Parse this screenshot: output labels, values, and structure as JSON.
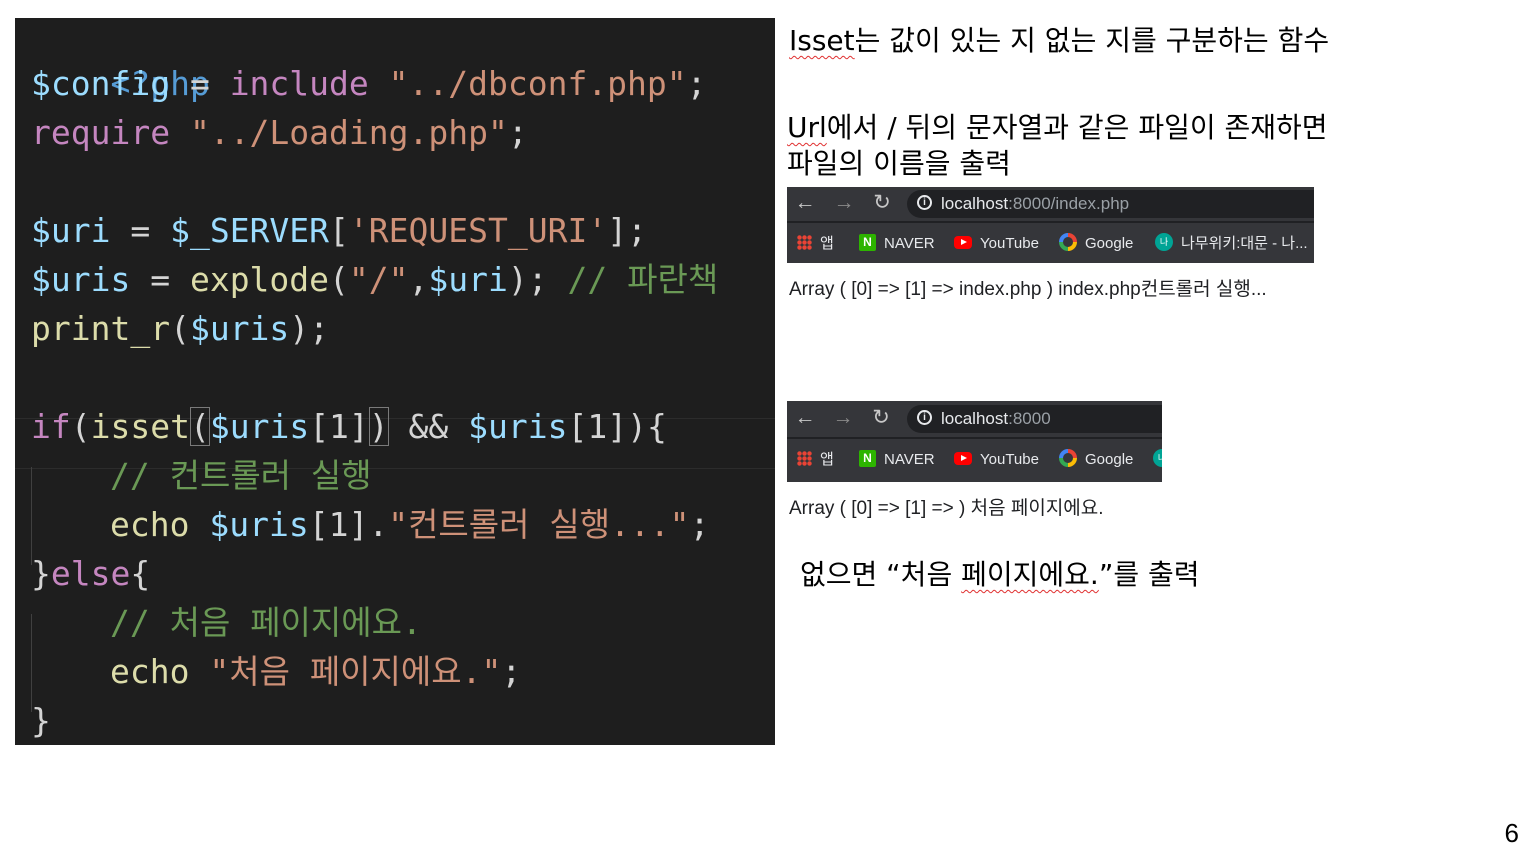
{
  "code": {
    "line1": {
      "tag": "<?php"
    },
    "line2": {
      "var": "$config",
      "op": " = ",
      "kw": "include",
      "sp": " ",
      "str": "\"../dbconf.php\"",
      "end": ";"
    },
    "line3": {
      "kw": "require",
      "sp": " ",
      "str": "\"../Loading.php\"",
      "end": ";"
    },
    "line4": {
      "var": "$uri",
      "op": " = ",
      "var2": "$_SERVER",
      "b1": "[",
      "str": "'REQUEST_URI'",
      "b2": "]",
      "end": ";"
    },
    "line5": {
      "var": "$uris",
      "op": " = ",
      "fn": "explode",
      "p1": "(",
      "str": "\"/\"",
      "comma": ",",
      "var2": "$uri",
      "p2": ")",
      "end": "; ",
      "com": "// 파란책"
    },
    "line6": {
      "fn": "print_r",
      "p1": "(",
      "var": "$uris",
      "p2": ")",
      "end": ";"
    },
    "line7": {
      "kw": "if",
      "p1": "(",
      "fn": "isset",
      "p2": "(",
      "var": "$uris",
      "idx": "[1]",
      "p3": ")",
      "and": " && ",
      "var2": "$uris",
      "idx2": "[1]",
      "p4": ")",
      "brace": "{"
    },
    "line8": {
      "com": "// 컨트롤러 실행"
    },
    "line9": {
      "fn": "echo",
      "sp": " ",
      "var": "$uris",
      "idx": "[1]",
      "dot": ".",
      "str": "\"컨트롤러 실행...\"",
      "end": ";"
    },
    "line10": {
      "brace": "}",
      "kw": "else",
      "brace2": "{"
    },
    "line11": {
      "com": "// 처음 페이지에요."
    },
    "line12": {
      "fn": "echo",
      "sp": " ",
      "str": "\"처음 페이지에요.\"",
      "end": ";"
    },
    "line13": {
      "brace": "}"
    }
  },
  "notes": {
    "isset_word": "Isset",
    "isset_rest": "는 값이 있는 지 없는 지를 구분하는 함수",
    "url_word": "Url",
    "url_rest": "에서 / 뒤의 문자열과 같은 파일이 존재하면",
    "url_line2": "파일의 이름을 출력",
    "none_prefix": "없으면 “처음 ",
    "none_squiggle": "페이지에요.",
    "none_suffix": "”를 출력"
  },
  "browser1": {
    "url_host": "localhost",
    "url_path": ":8000/index.php",
    "output": "Array ( [0] => [1] => index.php ) index.php컨트롤러 실행..."
  },
  "browser2": {
    "url_host": "localhost",
    "url_path": ":8000",
    "output": "Array ( [0] => [1] => ) 처음 페이지에요."
  },
  "bookmarks": {
    "apps": "앱",
    "naver": "NAVER",
    "youtube": "YouTube",
    "google": "Google",
    "namu": "나무위키:대문 - 나..."
  },
  "icons": {
    "back": "back-arrow-icon",
    "forward": "forward-arrow-icon",
    "reload": "reload-icon",
    "info": "info-icon"
  },
  "page_number": "6"
}
